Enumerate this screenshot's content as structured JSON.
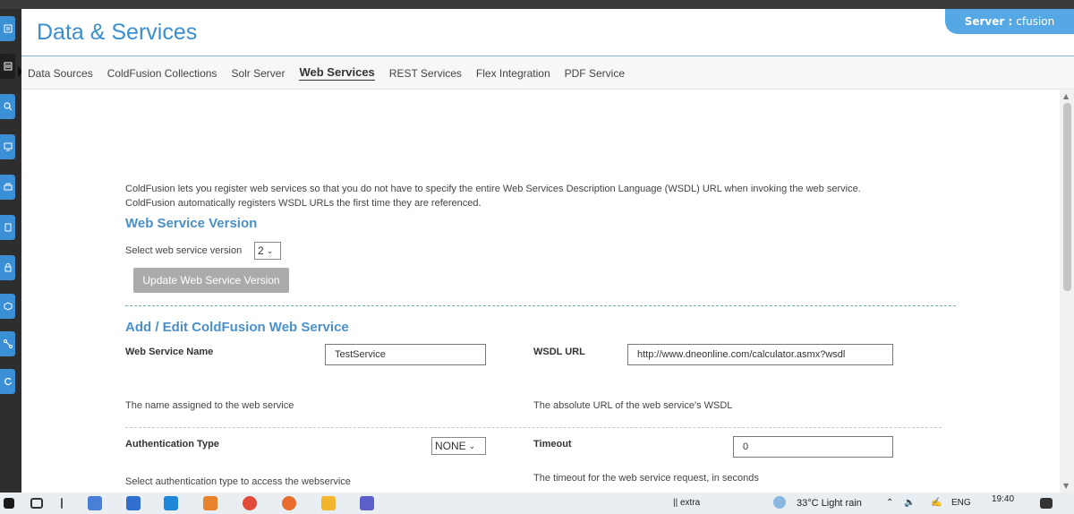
{
  "header": {
    "title": "Data & Services",
    "server_label": "Server :",
    "server_value": "cfusion"
  },
  "nav": {
    "tabs": [
      {
        "label": "Data Sources"
      },
      {
        "label": "ColdFusion Collections"
      },
      {
        "label": "Solr Server"
      },
      {
        "label": "Web Services",
        "active": true
      },
      {
        "label": "REST Services"
      },
      {
        "label": "Flex Integration"
      },
      {
        "label": "PDF Service"
      }
    ]
  },
  "intro": {
    "line1": "ColdFusion lets you register web services so that you do not have to specify the entire Web Services Description Language (WSDL) URL when invoking the web service.",
    "line2": "ColdFusion automatically registers WSDL URLs the first time they are referenced."
  },
  "version": {
    "title": "Web Service Version",
    "select_label": "Select web service version",
    "selected": "2",
    "update_button": "Update Web Service Version"
  },
  "edit": {
    "title": "Add / Edit ColdFusion Web Service",
    "name_label": "Web Service Name",
    "name_value": "TestService",
    "name_help": "The name assigned to the web service",
    "wsdl_label": "WSDL URL",
    "wsdl_value": "http://www.dneonline.com/calculator.asmx?wsdl",
    "wsdl_help": "The absolute URL of the web service's WSDL",
    "auth_label": "Authentication Type",
    "auth_value": "NONE",
    "auth_help": "Select authentication type to access the webservice",
    "timeout_label": "Timeout",
    "timeout_value": "0",
    "timeout_help": "The timeout for the web service request, in seconds"
  },
  "taskbar": {
    "toolbar_label": "extra",
    "weather": "33°C  Light rain",
    "lang": "ENG",
    "time": "19:40"
  },
  "colors": {
    "accent": "#3a8fd0",
    "rail_button": "#3b8fd4",
    "server_badge": "#55a8e3"
  },
  "icons": [
    "search-icon",
    "chevron-down-icon",
    "windows-start-icon",
    "chrome-icon",
    "vscode-icon"
  ]
}
